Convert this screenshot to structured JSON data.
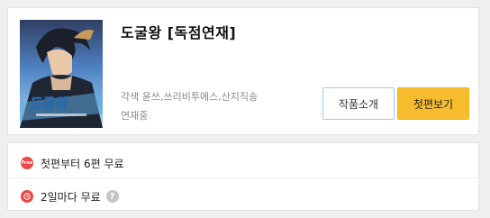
{
  "work": {
    "title": "도굴왕 [독점연재]",
    "authors": "각색 윤쓰,쓰리비투에스,산지직송",
    "status": "연재중",
    "cover_label": "도굴왕"
  },
  "buttons": {
    "intro_label": "작품소개",
    "first_episode_label": "첫편보기"
  },
  "benefits": {
    "free_badge": "Free",
    "free_text": "첫편부터 6편 무료",
    "wait_text": "2일마다 무료",
    "help_glyph": "?"
  },
  "colors": {
    "accent": "#f7bd2d",
    "badge_red": "#e84846",
    "intro_border": "#a8c8e8"
  },
  "icons": [
    "free-badge-icon",
    "clock-badge-icon",
    "help-icon"
  ]
}
